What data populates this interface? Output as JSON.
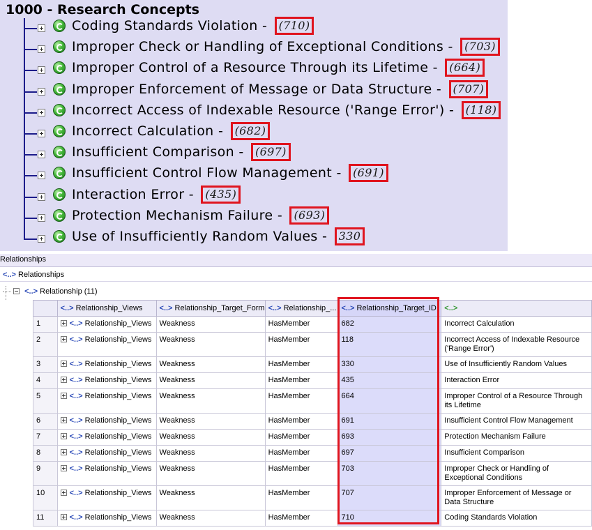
{
  "tree": {
    "title": "1000 - Research Concepts",
    "separator": "-",
    "nodes": [
      {
        "label": "Coding Standards Violation",
        "id": "(710)"
      },
      {
        "label": "Improper Check or Handling of Exceptional Conditions",
        "id": "(703)"
      },
      {
        "label": "Improper Control of a Resource Through its Lifetime",
        "id": "(664)"
      },
      {
        "label": "Improper Enforcement of Message or Data Structure",
        "id": "(707)"
      },
      {
        "label": "Incorrect Access of Indexable Resource ('Range Error')",
        "id": "(118)"
      },
      {
        "label": "Incorrect Calculation",
        "id": "(682)"
      },
      {
        "label": "Insufficient Comparison",
        "id": "(697)"
      },
      {
        "label": "Insufficient Control Flow Management",
        "id": "(691)"
      },
      {
        "label": "Interaction Error",
        "id": "(435)"
      },
      {
        "label": "Protection Mechanism Failure",
        "id": "(693)"
      },
      {
        "label": "Use of Insufficiently Random Values",
        "id": "330"
      }
    ]
  },
  "grid": {
    "panel_title": "Relationships",
    "header_icon": "<..>",
    "header_label": "Relationships",
    "group_label": "Relationship (11)",
    "columns": {
      "views": "Relationship_Views",
      "target_form": "Relationship_Target_Form",
      "nature": "Relationship_...",
      "target_id": "Relationship_Target_ID",
      "extra": "<..>"
    },
    "rows": [
      {
        "n": "1",
        "views": "Relationship_Views",
        "form": "Weakness",
        "nature": "HasMember",
        "id": "682",
        "name": "Incorrect Calculation"
      },
      {
        "n": "2",
        "views": "Relationship_Views",
        "form": "Weakness",
        "nature": "HasMember",
        "id": "118",
        "name": "Incorrect Access of Indexable Resource ('Range Error')"
      },
      {
        "n": "3",
        "views": "Relationship_Views",
        "form": "Weakness",
        "nature": "HasMember",
        "id": "330",
        "name": "Use of Insufficiently Random Values"
      },
      {
        "n": "4",
        "views": "Relationship_Views",
        "form": "Weakness",
        "nature": "HasMember",
        "id": "435",
        "name": "Interaction Error"
      },
      {
        "n": "5",
        "views": "Relationship_Views",
        "form": "Weakness",
        "nature": "HasMember",
        "id": "664",
        "name": "Improper Control of a Resource Through its Lifetime"
      },
      {
        "n": "6",
        "views": "Relationship_Views",
        "form": "Weakness",
        "nature": "HasMember",
        "id": "691",
        "name": "Insufficient Control Flow Management"
      },
      {
        "n": "7",
        "views": "Relationship_Views",
        "form": "Weakness",
        "nature": "HasMember",
        "id": "693",
        "name": "Protection Mechanism Failure"
      },
      {
        "n": "8",
        "views": "Relationship_Views",
        "form": "Weakness",
        "nature": "HasMember",
        "id": "697",
        "name": "Insufficient Comparison"
      },
      {
        "n": "9",
        "views": "Relationship_Views",
        "form": "Weakness",
        "nature": "HasMember",
        "id": "703",
        "name": "Improper Check or Handling of Exceptional Conditions"
      },
      {
        "n": "10",
        "views": "Relationship_Views",
        "form": "Weakness",
        "nature": "HasMember",
        "id": "707",
        "name": "Improper Enforcement of Message or Data Structure"
      },
      {
        "n": "11",
        "views": "Relationship_Views",
        "form": "Weakness",
        "nature": "HasMember",
        "id": "710",
        "name": "Coding Standards Violation"
      }
    ]
  },
  "colors": {
    "tree_background": "#dedcf3",
    "tree_line": "#1c1c8a",
    "highlight_border": "#e0141e",
    "target_id_column": "#dcdcfa",
    "tag_icon": "#2c4bb8"
  },
  "icons": {
    "tree_node": "green-refresh-circle-icon",
    "expand": "plus-box-icon",
    "collapse": "minus-box-icon",
    "xml_tag": "xml-tag-icon"
  }
}
